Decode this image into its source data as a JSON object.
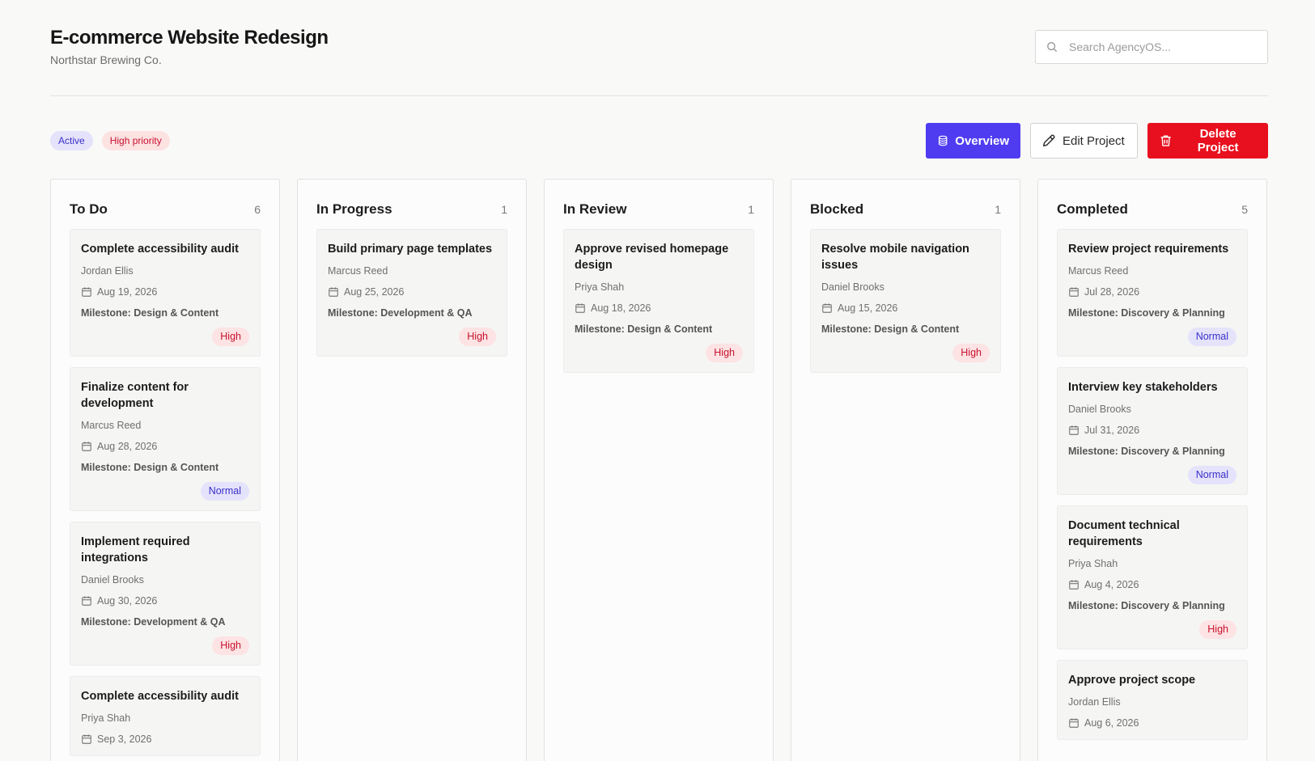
{
  "project": {
    "title": "E-commerce Website Redesign",
    "client": "Northstar Brewing Co."
  },
  "search": {
    "placeholder": "Search AgencyOS..."
  },
  "tags": {
    "status": "Active",
    "priority": "High priority"
  },
  "actions": {
    "overview": "Overview",
    "edit": "Edit Project",
    "delete": "Delete Project"
  },
  "colors": {
    "primary": "#4f3cf0",
    "danger": "#e8101f",
    "high": "#c8102e",
    "normal": "#3b2fc9"
  },
  "columns": [
    {
      "title": "To Do",
      "count": "6",
      "cards": [
        {
          "title": "Complete accessibility audit",
          "assignee": "Jordan Ellis",
          "date": "Aug 19, 2026",
          "milestone": "Milestone: Design & Content",
          "priority": "High",
          "level": "high"
        },
        {
          "title": "Finalize content for development",
          "assignee": "Marcus Reed",
          "date": "Aug 28, 2026",
          "milestone": "Milestone: Design & Content",
          "priority": "Normal",
          "level": "normal"
        },
        {
          "title": "Implement required integrations",
          "assignee": "Daniel Brooks",
          "date": "Aug 30, 2026",
          "milestone": "Milestone: Development & QA",
          "priority": "High",
          "level": "high"
        },
        {
          "title": "Complete accessibility audit",
          "assignee": "Priya Shah",
          "date": "Sep 3, 2026",
          "milestone": "",
          "priority": "",
          "level": ""
        }
      ]
    },
    {
      "title": "In Progress",
      "count": "1",
      "cards": [
        {
          "title": "Build primary page templates",
          "assignee": "Marcus Reed",
          "date": "Aug 25, 2026",
          "milestone": "Milestone: Development & QA",
          "priority": "High",
          "level": "high"
        }
      ]
    },
    {
      "title": "In Review",
      "count": "1",
      "cards": [
        {
          "title": "Approve revised homepage design",
          "assignee": "Priya Shah",
          "date": "Aug 18, 2026",
          "milestone": "Milestone: Design & Content",
          "priority": "High",
          "level": "high"
        }
      ]
    },
    {
      "title": "Blocked",
      "count": "1",
      "cards": [
        {
          "title": "Resolve mobile navigation issues",
          "assignee": "Daniel Brooks",
          "date": "Aug 15, 2026",
          "milestone": "Milestone: Design & Content",
          "priority": "High",
          "level": "high"
        }
      ]
    },
    {
      "title": "Completed",
      "count": "5",
      "cards": [
        {
          "title": "Review project requirements",
          "assignee": "Marcus Reed",
          "date": "Jul 28, 2026",
          "milestone": "Milestone: Discovery & Planning",
          "priority": "Normal",
          "level": "normal"
        },
        {
          "title": "Interview key stakeholders",
          "assignee": "Daniel Brooks",
          "date": "Jul 31, 2026",
          "milestone": "Milestone: Discovery & Planning",
          "priority": "Normal",
          "level": "normal"
        },
        {
          "title": "Document technical requirements",
          "assignee": "Priya Shah",
          "date": "Aug 4, 2026",
          "milestone": "Milestone: Discovery & Planning",
          "priority": "High",
          "level": "high"
        },
        {
          "title": "Approve project scope",
          "assignee": "Jordan Ellis",
          "date": "Aug 6, 2026",
          "milestone": "",
          "priority": "",
          "level": ""
        }
      ]
    }
  ]
}
